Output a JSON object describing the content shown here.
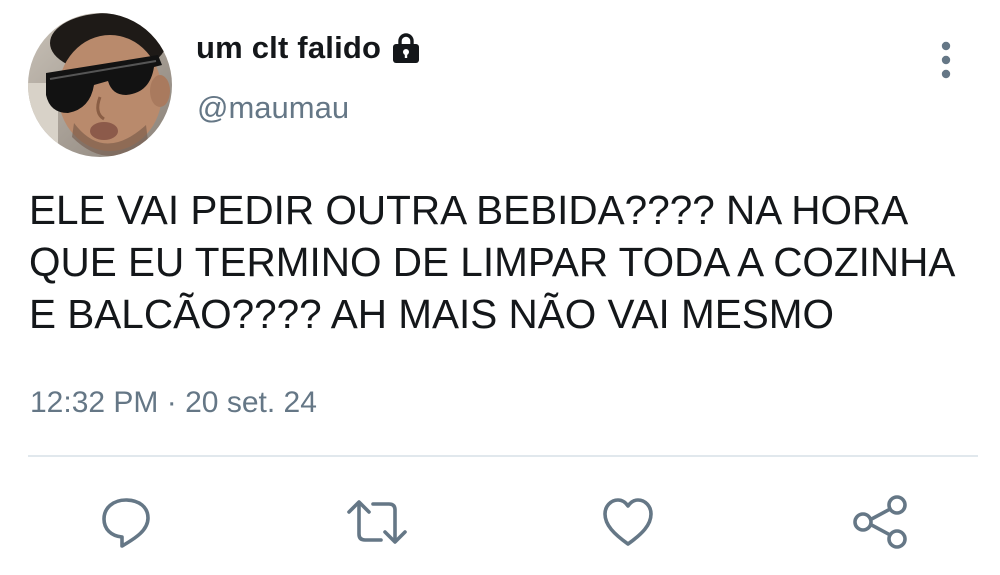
{
  "tweet": {
    "display_name": "um clt falido",
    "handle": "@maumau",
    "text": "ELE VAI PEDIR OUTRA BEBIDA???? NA HORA\nQUE EU TERMINO DE LIMPAR TODA A COZINHA\nE BALCÃO???? AH MAIS NÃO VAI MESMO",
    "time": "12:32 PM",
    "separator": "·",
    "date": "20 set. 24",
    "protected_icon": "lock-icon"
  },
  "actions": {
    "reply_icon": "reply-icon",
    "retweet_icon": "retweet-icon",
    "like_icon": "heart-icon",
    "share_icon": "share-icon"
  },
  "colors": {
    "text": "#14171a",
    "secondary": "#657786",
    "divider": "#e1e8ed",
    "icon": "#657786"
  }
}
